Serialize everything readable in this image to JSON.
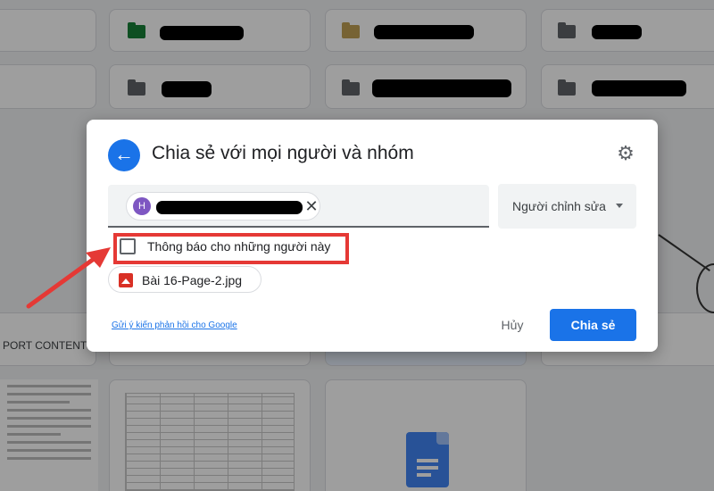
{
  "dialog": {
    "title": "Chia sẻ với mọi người và nhóm",
    "recipient": {
      "avatar_initial": "H"
    },
    "role": {
      "selected": "Người chỉnh sửa"
    },
    "notify": {
      "label": "Thông báo cho những người này",
      "checked": false
    },
    "attachment": {
      "file_name": "Bài 16-Page-2.jpg"
    },
    "feedback_link": "Gửi ý kiến phản hồi cho Google",
    "buttons": {
      "cancel": "Hủy",
      "share": "Chia sẻ"
    }
  },
  "background": {
    "left_card_label": "PORT CONTENT",
    "folder_colors": [
      "#188038",
      "#c0a055",
      "#5f6368"
    ]
  },
  "colors": {
    "accent": "#1a73e8",
    "annotation": "#e53935"
  },
  "icons": {
    "back": "arrow-left-icon",
    "settings": "gear-icon",
    "remove": "close-icon",
    "dropdown": "chevron-down-icon",
    "file": "image-file-icon"
  }
}
